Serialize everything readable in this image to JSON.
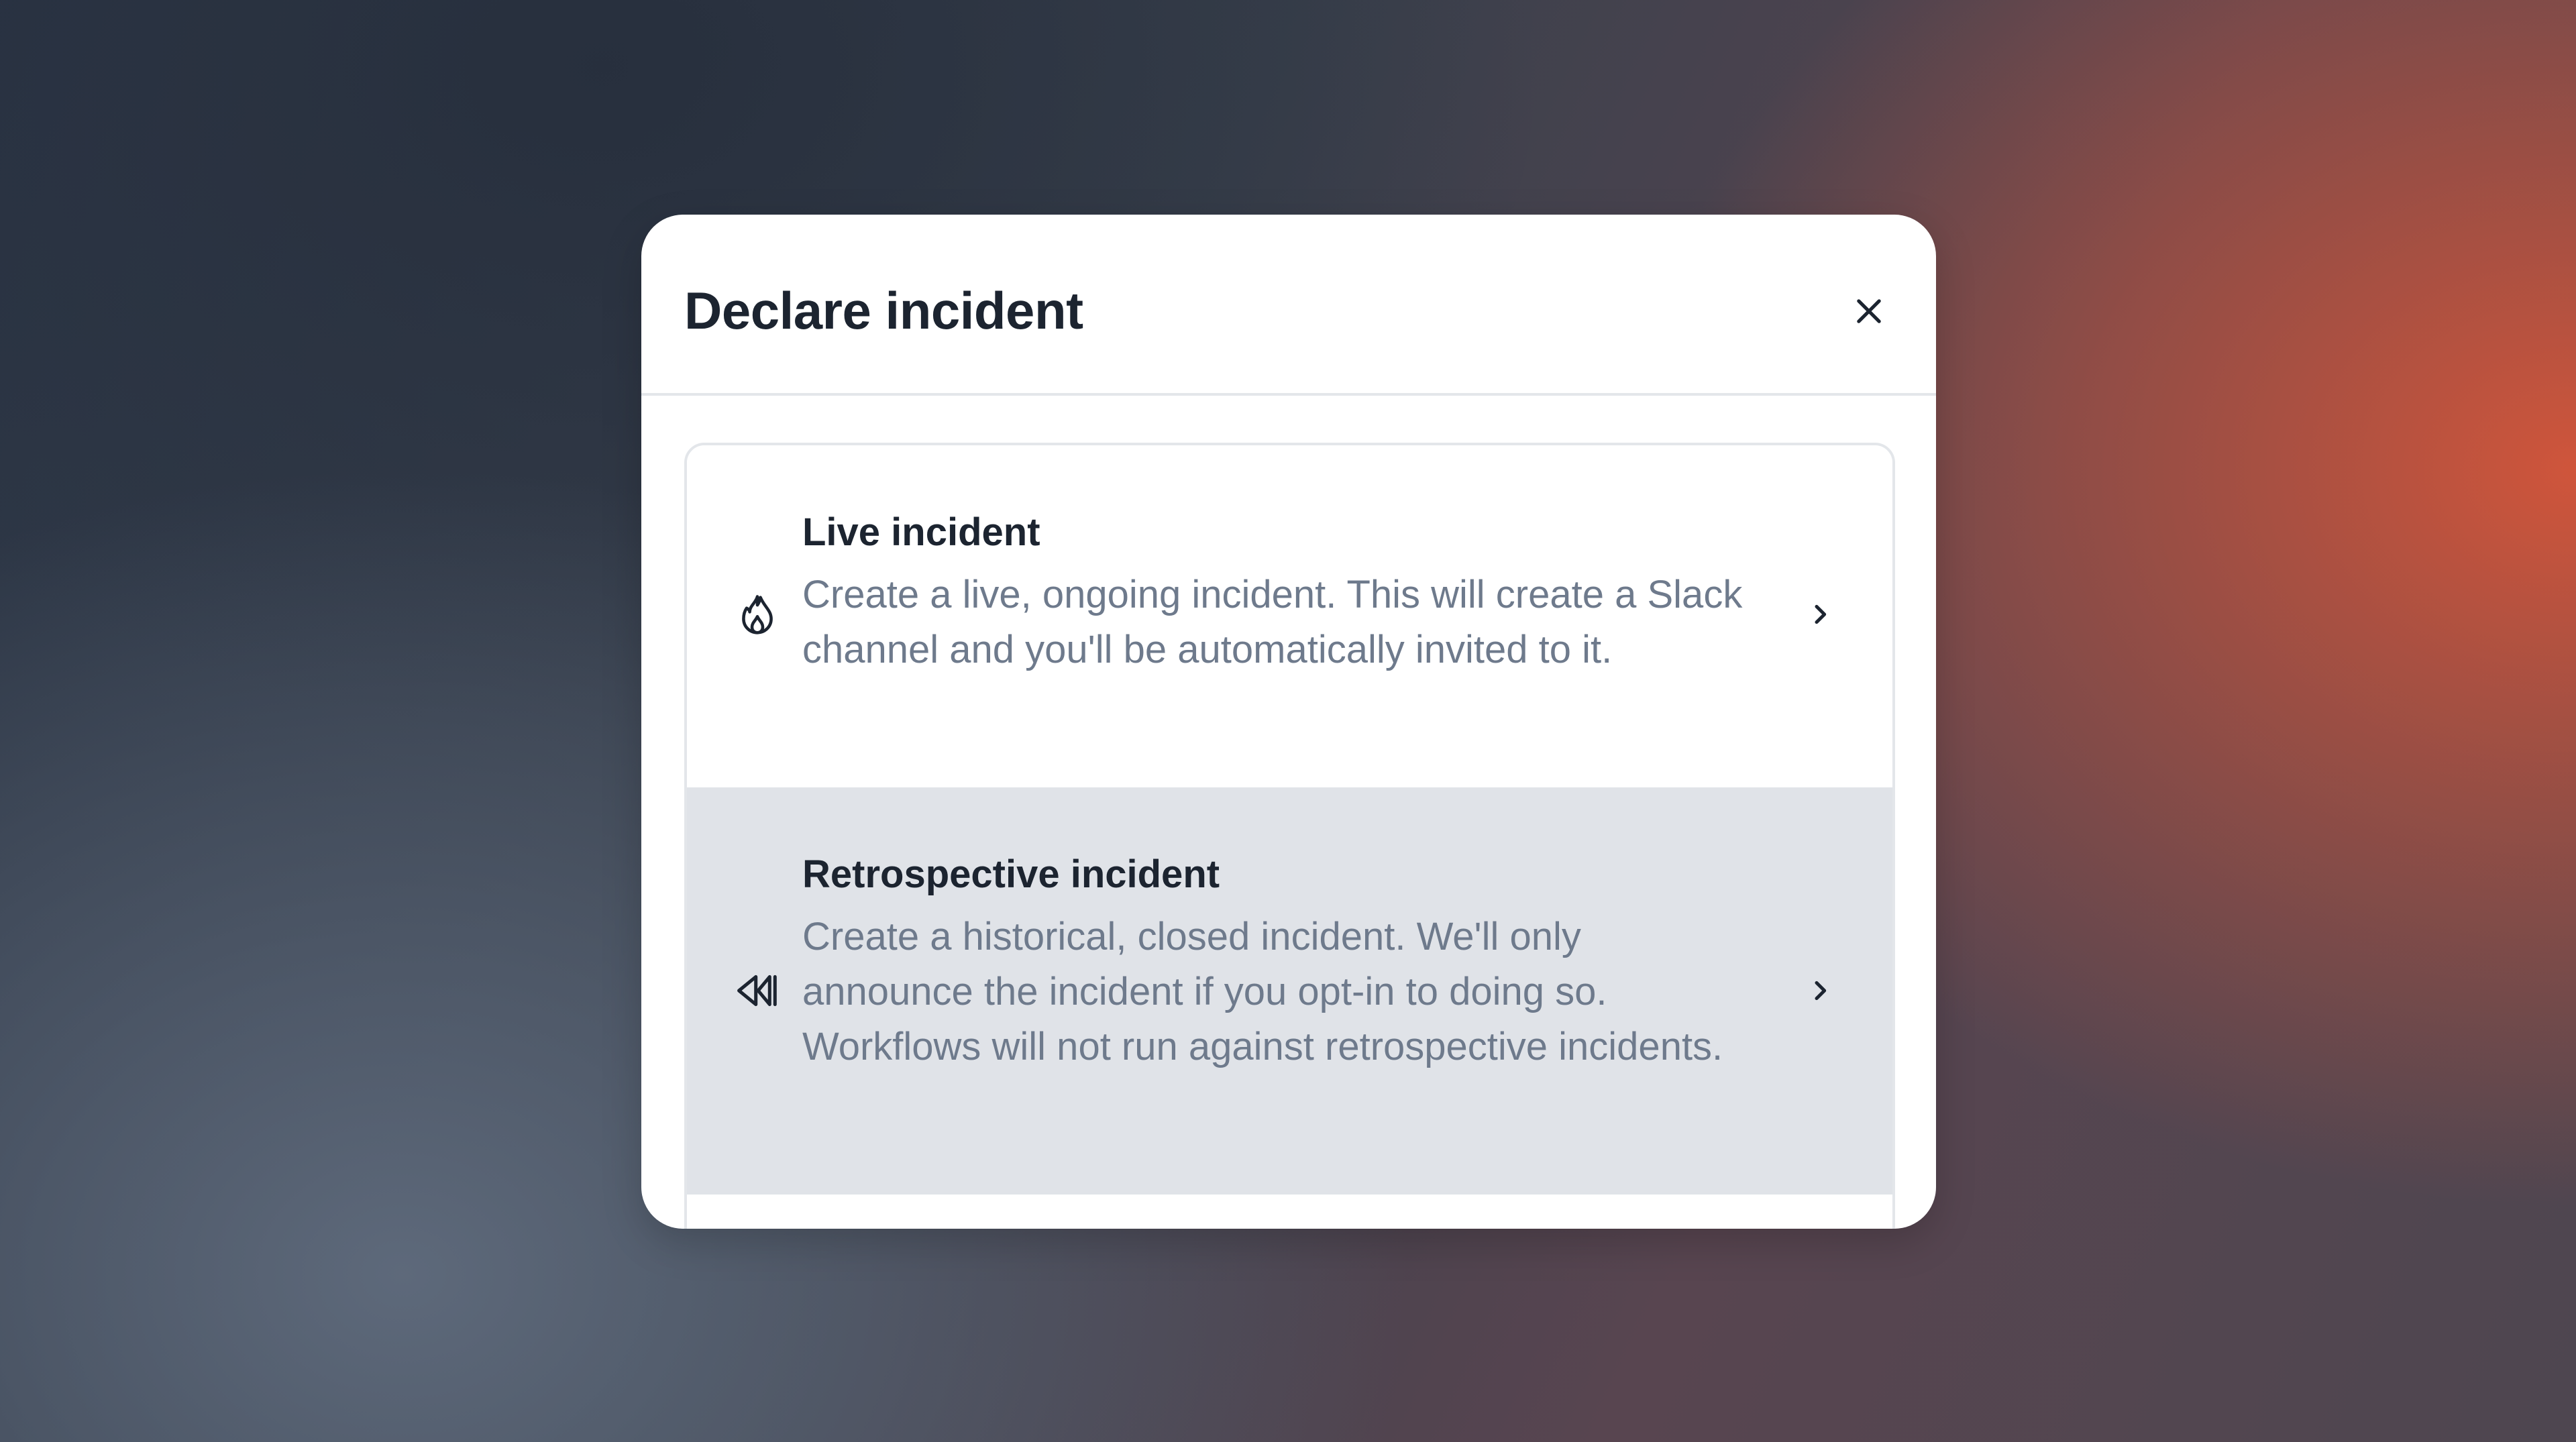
{
  "modal": {
    "title": "Declare incident",
    "close_icon": "close-icon"
  },
  "options": [
    {
      "title": "Live incident",
      "description": "Create a live, ongoing incident. This will create a Slack channel and you'll be automatically invited to it.",
      "icon": "flame-icon",
      "chevron": "chevron-right-icon"
    },
    {
      "title": "Retrospective incident",
      "description": "Create a historical, closed incident. We'll only announce the incident if you opt-in to doing so. Workflows will not run against retrospective incidents.",
      "icon": "rewind-icon",
      "chevron": "chevron-right-icon"
    }
  ],
  "colors": {
    "modal_bg": "#ffffff",
    "title_text": "#1c2430",
    "description_text": "#6e7a8c",
    "hover_option_bg": "#e0e3e8",
    "border": "#e3e6ea",
    "backdrop_accent": "#d6563a"
  }
}
